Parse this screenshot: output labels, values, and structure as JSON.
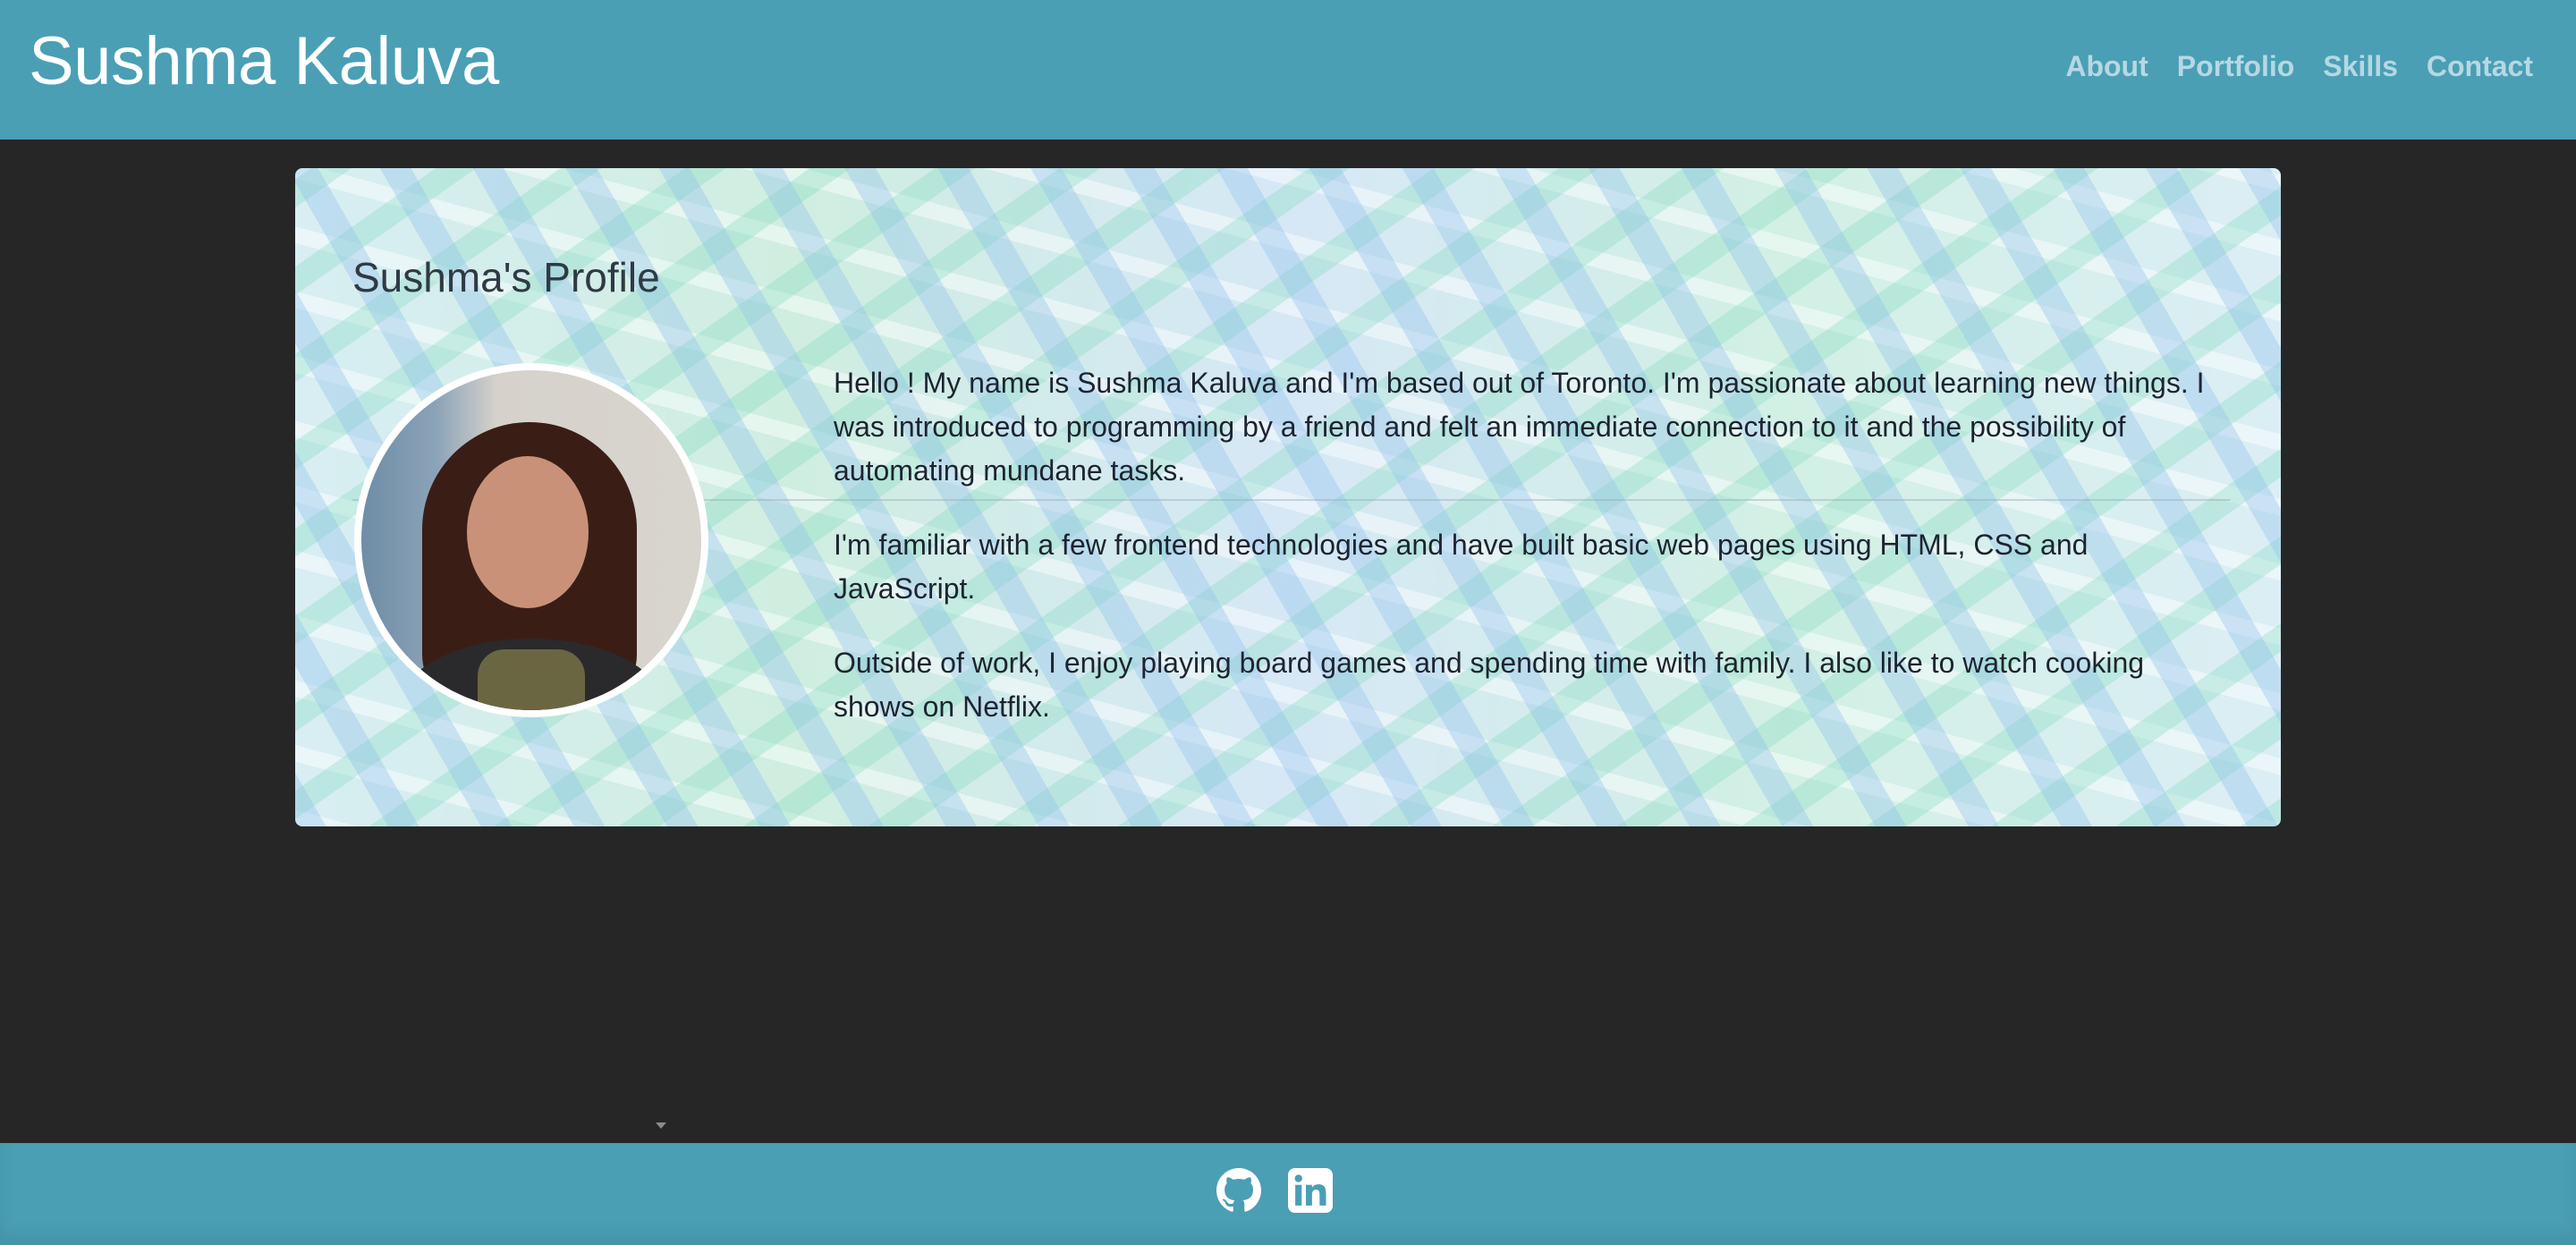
{
  "header": {
    "brand": "Sushma Kaluva",
    "nav": [
      {
        "label": "About"
      },
      {
        "label": "Portfolio"
      },
      {
        "label": "Skills"
      },
      {
        "label": "Contact"
      }
    ]
  },
  "profile": {
    "title": "Sushma's Profile",
    "avatar_icon": "profile-photo",
    "bio": [
      "Hello ! My name is Sushma Kaluva and I'm based out of Toronto. I'm passionate about learning new things. I was introduced to programming by a friend and felt an immediate connection to it and the possibility of automating mundane tasks.",
      "I'm familiar with a few frontend technologies and have built basic web pages using HTML, CSS and JavaScript.",
      "Outside of work, I enjoy playing board games and spending time with family. I also like to watch cooking shows on Netflix."
    ]
  },
  "footer": {
    "links": [
      {
        "icon": "github-icon"
      },
      {
        "icon": "linkedin-icon"
      }
    ]
  },
  "colors": {
    "header_bg": "#4a9fb5",
    "footer_bg": "#4a9fb5",
    "page_bg": "#262626",
    "nav_text": "#b6d8e2",
    "brand_text": "#ffffff"
  }
}
